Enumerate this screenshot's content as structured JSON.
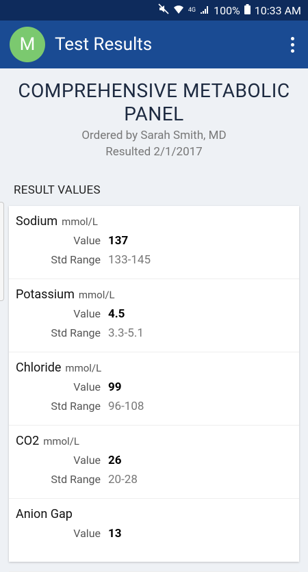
{
  "status": {
    "battery": "100%",
    "time": "10:33 AM",
    "network": "4G"
  },
  "appbar": {
    "avatar_letter": "M",
    "title": "Test Results"
  },
  "panel": {
    "title": "COMPREHENSIVE METABOLIC PANEL",
    "ordered_by": "Ordered by Sarah Smith, MD",
    "resulted": "Resulted 2/1/2017"
  },
  "section_label": "RESULT VALUES",
  "labels": {
    "value": "Value",
    "std_range": "Std Range"
  },
  "results": [
    {
      "name": "Sodium",
      "unit": "mmol/L",
      "value": "137",
      "range": "133-145"
    },
    {
      "name": "Potassium",
      "unit": "mmol/L",
      "value": "4.5",
      "range": "3.3-5.1"
    },
    {
      "name": "Chloride",
      "unit": "mmol/L",
      "value": "99",
      "range": "96-108"
    },
    {
      "name": "CO2",
      "unit": "mmol/L",
      "value": "26",
      "range": "20-28"
    },
    {
      "name": "Anion Gap",
      "unit": "",
      "value": "13",
      "range": ""
    }
  ]
}
